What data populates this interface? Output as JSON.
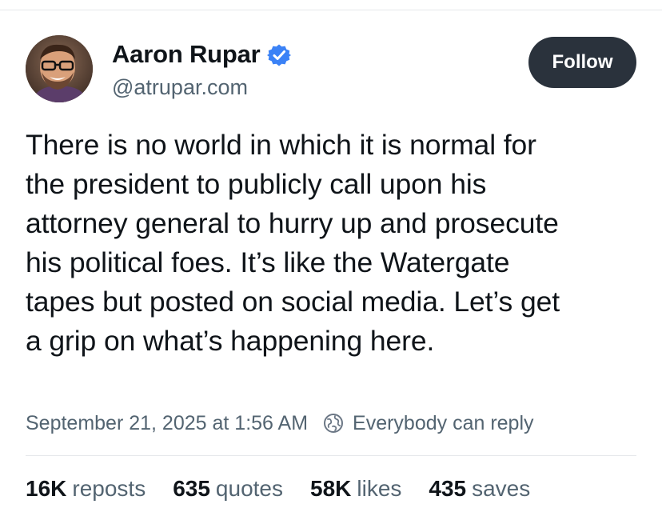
{
  "author": {
    "display_name": "Aaron Rupar",
    "handle": "@atrupar.com",
    "avatar_icon": "person-with-glasses-avatar",
    "verified_icon": "blue-check-badge-icon",
    "verified_color": "#3b82f6"
  },
  "follow_button": {
    "label": "Follow",
    "background": "#2a323c"
  },
  "post": {
    "text": "There is no world in which it is normal for\nthe president to publicly call upon his\nattorney general to hurry up and prosecute\nhis political foes. It’s like the Watergate\ntapes but posted on social media. Let’s get\na grip on what’s happening here."
  },
  "meta": {
    "timestamp": "September 21, 2025 at 1:56 AM",
    "reply_icon": "globe-icon",
    "reply_setting": "Everybody can reply"
  },
  "stats": [
    {
      "count": "16K",
      "label": "reposts"
    },
    {
      "count": "635",
      "label": "quotes"
    },
    {
      "count": "58K",
      "label": "likes"
    },
    {
      "count": "435",
      "label": "saves"
    }
  ]
}
